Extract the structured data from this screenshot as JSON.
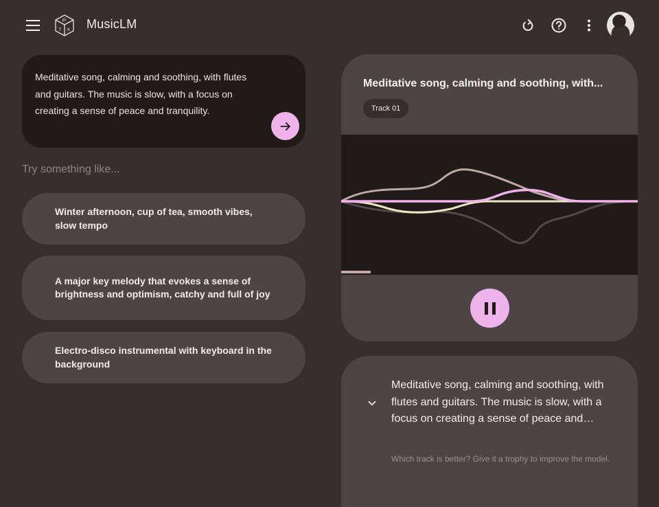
{
  "header": {
    "menu_icon": "hamburger-menu-icon",
    "logo_icon": "aitk-cube-logo",
    "app_title": "MusicLM",
    "actions": [
      {
        "name": "refresh",
        "icon": "refresh-icon"
      },
      {
        "name": "help",
        "icon": "help-circle-icon"
      },
      {
        "name": "more",
        "icon": "more-vert-icon"
      }
    ],
    "avatar": "user-avatar"
  },
  "prompt": {
    "text": "Meditative song, calming and soothing, with flutes and guitars. The music is slow, with a focus on creating a sense of peace and tranquility.",
    "send_icon": "arrow-right-icon"
  },
  "suggestions": {
    "label": "Try something like...",
    "items": [
      {
        "text": "Winter afternoon, cup of tea, smooth vibes, slow tempo"
      },
      {
        "text": "A major key melody that evokes a sense of brightness and optimism, catchy and full of joy"
      },
      {
        "text": "Electro-disco instrumental with keyboard in the background"
      }
    ]
  },
  "player": {
    "title": "Meditative song, calming and soothing, with...",
    "track_label": "Track 01",
    "progress": 0.1,
    "state": "playing",
    "pause_icon": "pause-icon",
    "colors": {
      "accent": "#efb2ea",
      "wave_mauve": "#bfa7a2",
      "wave_cream": "#ece6c2",
      "wave_gray": "#4c4543",
      "wave_pink": "#efb2ea"
    }
  },
  "description": {
    "text": "Meditative song, calming and soothing, with flutes and guitars. The music is slow, with a focus on creating a sense of peace and tranquility.",
    "feedback": "Which track is better? Give it a trophy to improve the model.",
    "expand_icon": "chevron-down-icon"
  }
}
